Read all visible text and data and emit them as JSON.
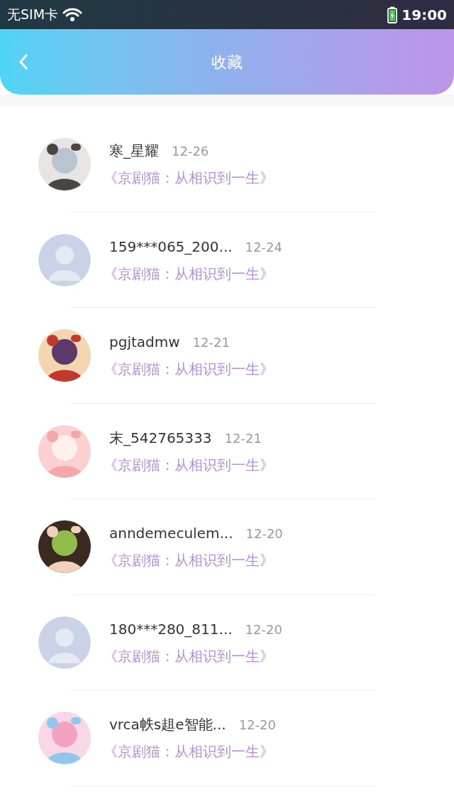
{
  "status_bar": {
    "carrier": "无SIM卡",
    "time": "19:00"
  },
  "header": {
    "title": "收藏"
  },
  "items": [
    {
      "name": "寒_星耀",
      "date": "12-26",
      "work": "《京剧猫：从相识到一生》"
    },
    {
      "name": "159***065_200...",
      "date": "12-24",
      "work": "《京剧猫：从相识到一生》",
      "avatar": {
        "kind": "default"
      }
    },
    {
      "name": "pgjtadmw",
      "date": "12-21",
      "work": "《京剧猫：从相识到一生》"
    },
    {
      "name": "末_542765333",
      "date": "12-21",
      "work": "《京剧猫：从相识到一生》"
    },
    {
      "name": "anndemeculem...",
      "date": "12-20",
      "work": "《京剧猫：从相识到一生》"
    },
    {
      "name": "180***280_811...",
      "date": "12-20",
      "work": "《京剧猫：从相识到一生》",
      "avatar": {
        "kind": "default"
      }
    },
    {
      "name": "vrca帙s趄e智能...",
      "date": "12-20",
      "work": "《京剧猫：从相识到一生》"
    }
  ]
}
